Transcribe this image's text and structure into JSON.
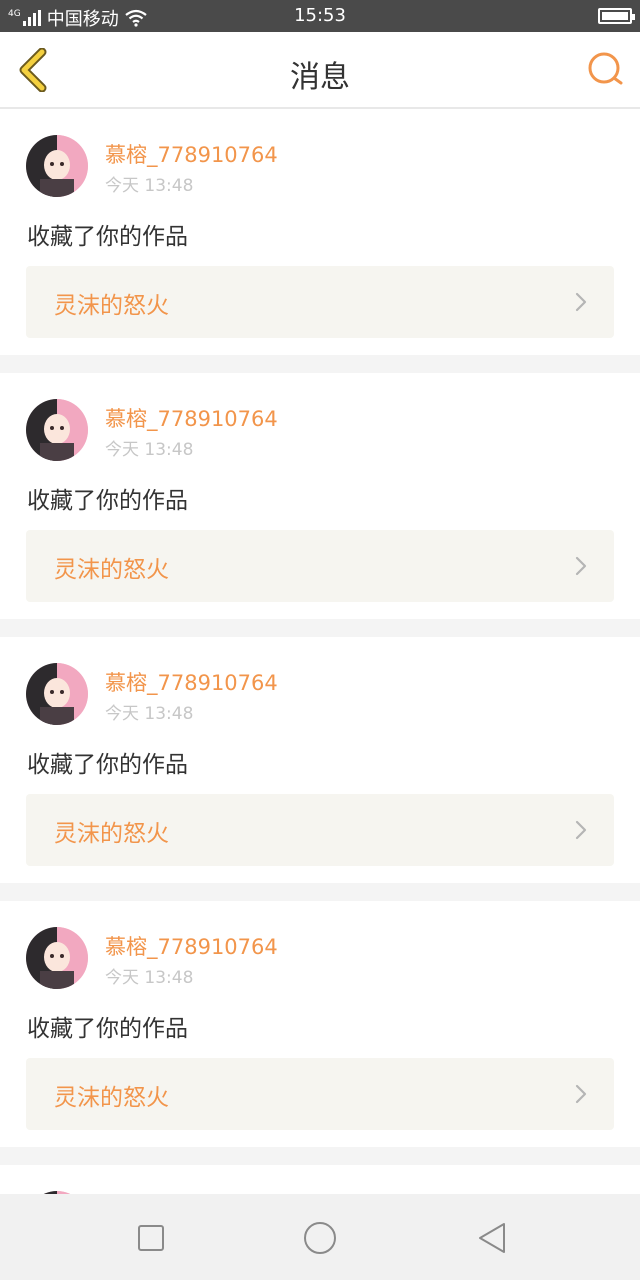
{
  "status_bar": {
    "network": "4G",
    "carrier": "中国移动",
    "time": "15:53",
    "battery_level": 1.0
  },
  "header": {
    "title": "消息",
    "back_icon": "chevron-left-icon",
    "search_icon": "search-icon",
    "accent_color": "#f2954b"
  },
  "messages": [
    {
      "username": "慕榕_778910764",
      "time": "今天 13:48",
      "action": "收藏了你的作品",
      "work_title": "灵沫的怒火"
    },
    {
      "username": "慕榕_778910764",
      "time": "今天 13:48",
      "action": "收藏了你的作品",
      "work_title": "灵沫的怒火"
    },
    {
      "username": "慕榕_778910764",
      "time": "今天 13:48",
      "action": "收藏了你的作品",
      "work_title": "灵沫的怒火"
    },
    {
      "username": "慕榕_778910764",
      "time": "今天 13:48",
      "action": "收藏了你的作品",
      "work_title": "灵沫的怒火"
    }
  ],
  "nav_bar": {
    "recent_icon": "square-icon",
    "home_icon": "circle-icon",
    "back_icon": "triangle-back-icon"
  }
}
